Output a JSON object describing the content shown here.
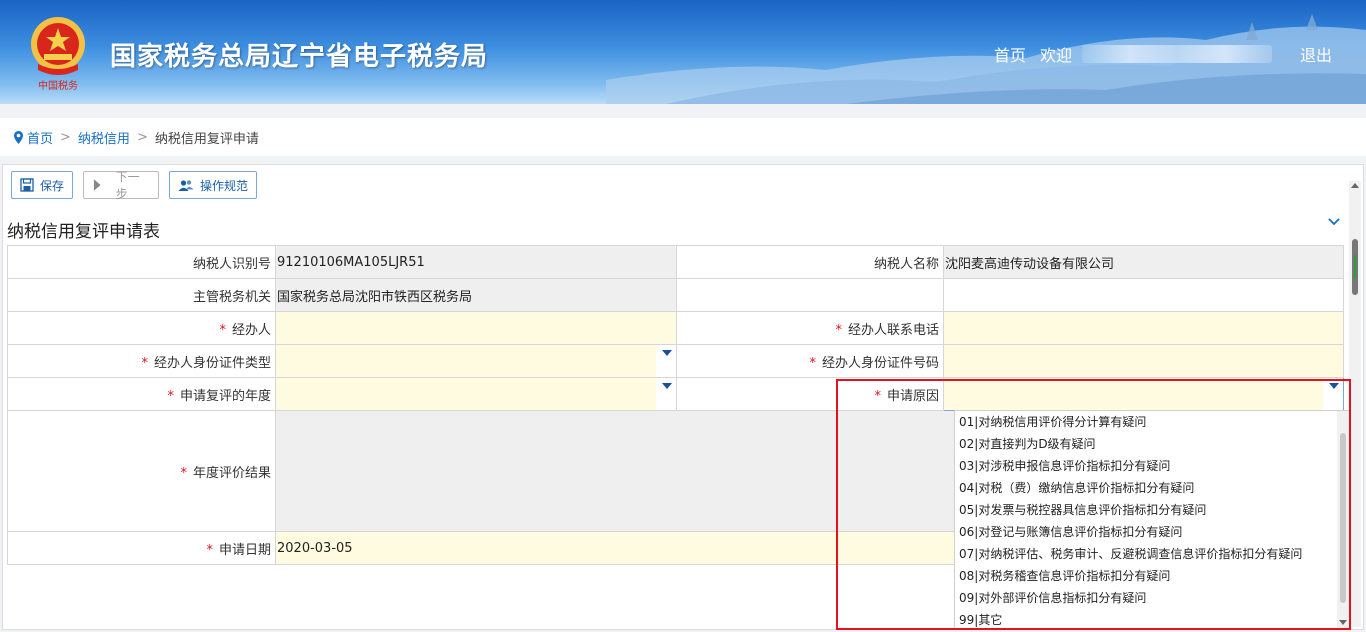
{
  "header": {
    "site_title": "国家税务总局辽宁省电子税务局",
    "emblem_caption": "中国税务",
    "nav_home": "首页",
    "nav_welcome": "欢迎",
    "nav_logout": "退出"
  },
  "breadcrumb": {
    "home": "首页",
    "sep1": ">",
    "level2": "纳税信用",
    "sep2": ">",
    "current": "纳税信用复评申请"
  },
  "toolbar": {
    "save": "保存",
    "next": "下一步",
    "guide": "操作规范"
  },
  "form": {
    "title": "纳税信用复评申请表",
    "required_mark": "*",
    "taxpayer_id_label": "纳税人识别号",
    "taxpayer_id_value": "91210106MA105LJR51",
    "taxpayer_name_label": "纳税人名称",
    "taxpayer_name_value": "沈阳麦高迪传动设备有限公司",
    "tax_authority_label": "主管税务机关",
    "tax_authority_value": "国家税务总局沈阳市铁西区税务局",
    "handler_label": "经办人",
    "handler_phone_label": "经办人联系电话",
    "id_type_label": "经办人身份证件类型",
    "id_number_label": "经办人身份证件号码",
    "review_year_label": "申请复评的年度",
    "reason_label": "申请原因",
    "annual_result_label": "年度评价结果",
    "apply_date_label": "申请日期",
    "apply_date_value": "2020-03-05"
  },
  "reason_options": [
    "01|对纳税信用评价得分计算有疑问",
    "02|对直接判为D级有疑问",
    "03|对涉税申报信息评价指标扣分有疑问",
    "04|对税（费）缴纳信息评价指标扣分有疑问",
    "05|对发票与税控器具信息评价指标扣分有疑问",
    "06|对登记与账簿信息评价指标扣分有疑问",
    "07|对纳税评估、税务审计、反避税调查信息评价指标扣分有疑问",
    "08|对税务稽查信息评价指标扣分有疑问",
    "09|对外部评价信息指标扣分有疑问",
    "99|其它"
  ],
  "colors": {
    "required": "#e0101a",
    "link": "#1a6fc7",
    "input_bg": "#fffbe0",
    "readonly_bg": "#efefef",
    "highlight": "#e8101a"
  }
}
